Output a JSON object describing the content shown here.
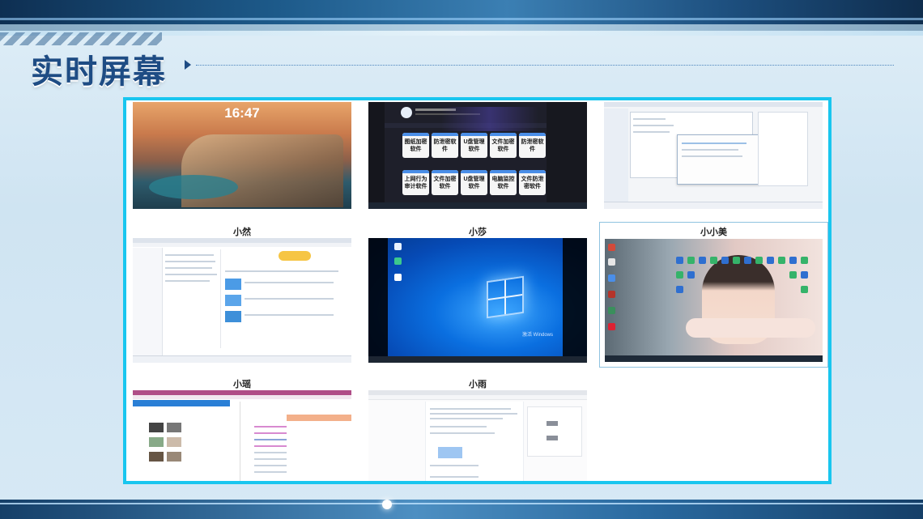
{
  "page": {
    "title": "实时屏幕"
  },
  "screens": [
    {
      "name": "",
      "kind": "lockscreen",
      "clock": "16:47"
    },
    {
      "name": "",
      "kind": "wechat-channel",
      "tiles": [
        "图纸加密软件",
        "防泄密软件",
        "U盘管理软件",
        "文件加密软件",
        "防泄密软件",
        "上网行为审计软件",
        "文件加密软件",
        "U盘管理软件",
        "电脑监控软件",
        "文件防泄密软件"
      ]
    },
    {
      "name": "",
      "kind": "file-manager"
    },
    {
      "name": "小然",
      "kind": "browser-doc"
    },
    {
      "name": "小莎",
      "kind": "windows-desktop",
      "watermark": "激活 Windows"
    },
    {
      "name": "小小美",
      "kind": "wallpaper-desktop"
    },
    {
      "name": "小瑶",
      "kind": "spreadsheet"
    },
    {
      "name": "小雨",
      "kind": "web-form"
    }
  ],
  "colors": {
    "frame": "#19c6ef",
    "title": "#1e4c84"
  }
}
